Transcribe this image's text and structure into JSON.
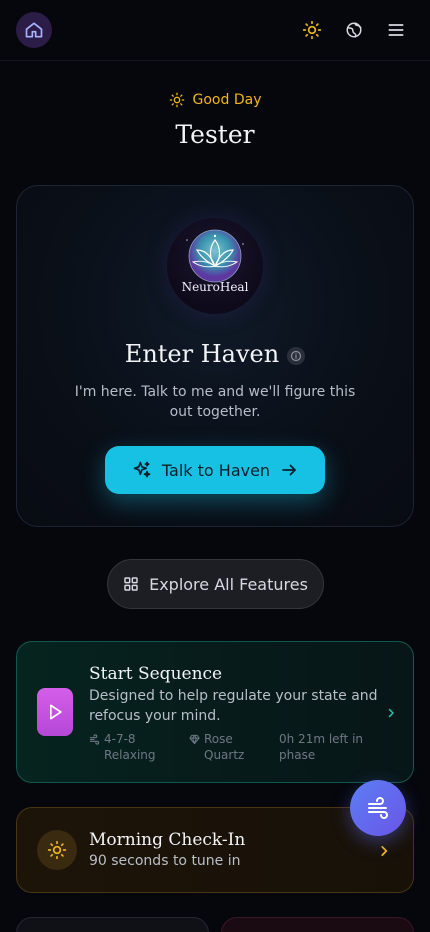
{
  "greeting": {
    "text": "Good Day",
    "icon": "sun-icon",
    "color": "#f1b51c"
  },
  "user": {
    "name": "Tester"
  },
  "haven": {
    "logo_text": "NeuroHeal",
    "title": "Enter Haven",
    "subtitle": "I'm here. Talk to me and we'll figure this out together.",
    "cta_label": "Talk to Haven",
    "accent": "#16c1e4"
  },
  "explore": {
    "label": "Explore All Features"
  },
  "sequence": {
    "title": "Start Sequence",
    "description": "Designed to help regulate your state and refocus your mind.",
    "meta_breath": "4-7-8 Relaxing",
    "meta_crystal": "Rose Quartz",
    "meta_phase": "0h 21m left in phase"
  },
  "checkin": {
    "title": "Morning Check-In",
    "subtitle": "90 seconds to tune in"
  },
  "colors": {
    "background": "#05070c",
    "amber": "#f1b51c",
    "play_tile": "#c853e0",
    "fab": "#5b7ef3"
  }
}
